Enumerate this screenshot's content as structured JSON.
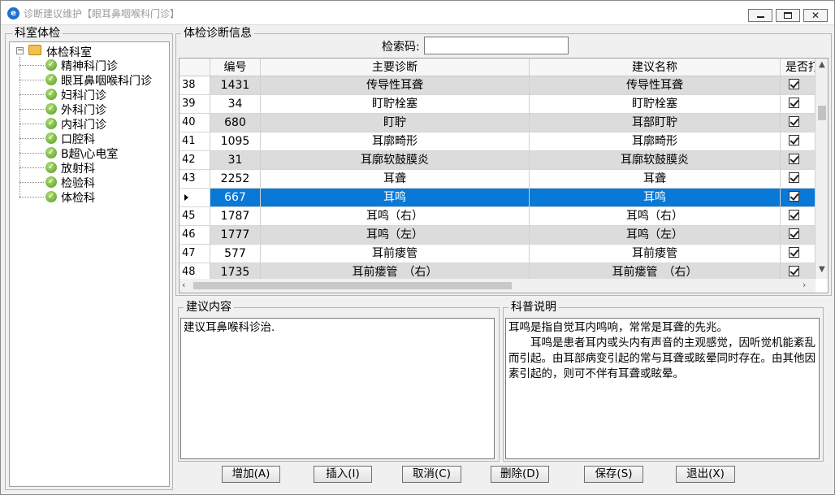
{
  "window": {
    "title": "诊断建议维护【眼耳鼻咽喉科门诊】"
  },
  "left_panel": {
    "legend": "科室体检",
    "tree": {
      "root_label": "体检科室",
      "items": [
        "精神科门诊",
        "眼耳鼻咽喉科门诊",
        "妇科门诊",
        "外科门诊",
        "内科门诊",
        "口腔科",
        "B超\\心电室",
        "放射科",
        "检验科",
        "体检科"
      ]
    }
  },
  "right_panel": {
    "legend": "体检诊断信息",
    "search": {
      "label": "检索码:",
      "value": "",
      "placeholder": ""
    },
    "grid": {
      "columns": [
        "编号",
        "主要诊断",
        "建议名称",
        "是否打"
      ],
      "rows": [
        {
          "row": "38",
          "id": "1431",
          "diagnosis": "传导性耳聋",
          "advice": "传导性耳聋",
          "checked": true
        },
        {
          "row": "39",
          "id": "34",
          "diagnosis": "盯聍栓塞",
          "advice": "盯聍栓塞",
          "checked": true
        },
        {
          "row": "40",
          "id": "680",
          "diagnosis": "盯聍",
          "advice": "耳部盯聍",
          "checked": true
        },
        {
          "row": "41",
          "id": "1095",
          "diagnosis": "耳廓畸形",
          "advice": "耳廓畸形",
          "checked": true
        },
        {
          "row": "42",
          "id": "31",
          "diagnosis": "耳廓软鼓膜炎",
          "advice": "耳廓软鼓膜炎",
          "checked": true
        },
        {
          "row": "43",
          "id": "2252",
          "diagnosis": "耳聋",
          "advice": "耳聋",
          "checked": true
        },
        {
          "row": "",
          "id": "667",
          "diagnosis": "耳鸣",
          "advice": "耳鸣",
          "checked": true,
          "selected": true
        },
        {
          "row": "45",
          "id": "1787",
          "diagnosis": "耳鸣（右）",
          "advice": "耳鸣（右）",
          "checked": true
        },
        {
          "row": "46",
          "id": "1777",
          "diagnosis": "耳鸣（左）",
          "advice": "耳鸣（左）",
          "checked": true
        },
        {
          "row": "47",
          "id": "577",
          "diagnosis": "耳前瘘管",
          "advice": "耳前瘘管",
          "checked": true
        },
        {
          "row": "48",
          "id": "1735",
          "diagnosis": "耳前瘘管　（右）",
          "advice": "耳前瘘管　（右）",
          "checked": true
        }
      ]
    }
  },
  "advice_box": {
    "legend": "建议内容",
    "text": "建议耳鼻喉科诊治."
  },
  "science_box": {
    "legend": "科普说明",
    "paragraphs": [
      "耳鸣是指自觉耳内鸣响，常常是耳聋的先兆。",
      "耳鸣是患者耳内或头内有声音的主观感觉，因听觉机能紊乱而引起。由耳部病变引起的常与耳聋或眩晕同时存在。由其他因素引起的，则可不伴有耳聋或眩晕。"
    ]
  },
  "buttons": {
    "add": "增加(A)",
    "insert": "插入(I)",
    "cancel": "取消(C)",
    "delete": "删除(D)",
    "save": "保存(S)",
    "exit": "退出(X)"
  },
  "colors": {
    "selection": "#0a78d7",
    "alt_row": "#dcdcdc",
    "tree_check": "#4f9a1e"
  }
}
